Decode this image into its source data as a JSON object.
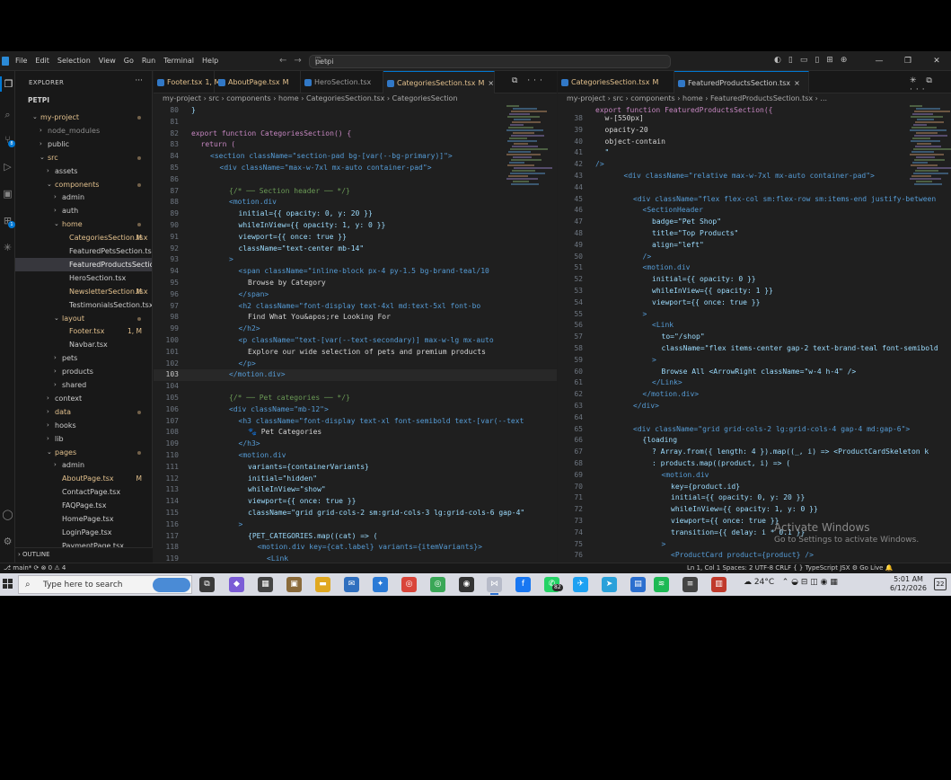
{
  "menu": [
    "File",
    "Edit",
    "Selection",
    "View",
    "Go",
    "Run",
    "Terminal",
    "Help"
  ],
  "command_center": "petpi",
  "sidebar": {
    "title": "EXPLORER",
    "root": "PETPI",
    "outline": "OUTLINE",
    "rows": [
      {
        "label": "my-project",
        "depth": 0,
        "chev": "⌄",
        "color": "#e2c08d",
        "dot": true
      },
      {
        "label": "node_modules",
        "depth": 1,
        "chev": "›",
        "color": "#8c8c8c"
      },
      {
        "label": "public",
        "depth": 1,
        "chev": "›",
        "color": "#cccccc"
      },
      {
        "label": "src",
        "depth": 1,
        "chev": "⌄",
        "color": "#e2c08d",
        "dot": true
      },
      {
        "label": "assets",
        "depth": 2,
        "chev": "›",
        "color": "#cccccc"
      },
      {
        "label": "components",
        "depth": 2,
        "chev": "⌄",
        "color": "#e2c08d",
        "dot": true
      },
      {
        "label": "admin",
        "depth": 3,
        "chev": "›",
        "color": "#cccccc"
      },
      {
        "label": "auth",
        "depth": 3,
        "chev": "›",
        "color": "#cccccc"
      },
      {
        "label": "home",
        "depth": 3,
        "chev": "⌄",
        "color": "#e2c08d",
        "dot": true
      },
      {
        "label": "CategoriesSection.tsx",
        "depth": 4,
        "chev": "",
        "color": "#e2c08d",
        "status": "M"
      },
      {
        "label": "FeaturedPetsSection.tsx",
        "depth": 4,
        "chev": "",
        "color": "#cccccc"
      },
      {
        "label": "FeaturedProductsSection...",
        "depth": 4,
        "chev": "",
        "color": "#e8e8e8",
        "selected": true
      },
      {
        "label": "HeroSection.tsx",
        "depth": 4,
        "chev": "",
        "color": "#cccccc"
      },
      {
        "label": "NewsletterSection.tsx",
        "depth": 4,
        "chev": "",
        "color": "#e2c08d",
        "status": "M"
      },
      {
        "label": "TestimonialsSection.tsx",
        "depth": 4,
        "chev": "",
        "color": "#cccccc"
      },
      {
        "label": "layout",
        "depth": 3,
        "chev": "⌄",
        "color": "#e2c08d",
        "dot": true
      },
      {
        "label": "Footer.tsx",
        "depth": 4,
        "chev": "",
        "color": "#e2c08d",
        "status": "1, M"
      },
      {
        "label": "Navbar.tsx",
        "depth": 4,
        "chev": "",
        "color": "#cccccc"
      },
      {
        "label": "pets",
        "depth": 3,
        "chev": "›",
        "color": "#cccccc"
      },
      {
        "label": "products",
        "depth": 3,
        "chev": "›",
        "color": "#cccccc"
      },
      {
        "label": "shared",
        "depth": 3,
        "chev": "›",
        "color": "#cccccc"
      },
      {
        "label": "context",
        "depth": 2,
        "chev": "›",
        "color": "#cccccc"
      },
      {
        "label": "data",
        "depth": 2,
        "chev": "›",
        "color": "#e2c08d",
        "dot": true
      },
      {
        "label": "hooks",
        "depth": 2,
        "chev": "›",
        "color": "#cccccc"
      },
      {
        "label": "lib",
        "depth": 2,
        "chev": "›",
        "color": "#cccccc"
      },
      {
        "label": "pages",
        "depth": 2,
        "chev": "⌄",
        "color": "#e2c08d",
        "dot": true
      },
      {
        "label": "admin",
        "depth": 3,
        "chev": "›",
        "color": "#cccccc"
      },
      {
        "label": "AboutPage.tsx",
        "depth": 3,
        "chev": "",
        "color": "#e2c08d",
        "status": "M"
      },
      {
        "label": "ContactPage.tsx",
        "depth": 3,
        "chev": "",
        "color": "#cccccc"
      },
      {
        "label": "FAQPage.tsx",
        "depth": 3,
        "chev": "",
        "color": "#cccccc"
      },
      {
        "label": "HomePage.tsx",
        "depth": 3,
        "chev": "",
        "color": "#cccccc"
      },
      {
        "label": "LoginPage.tsx",
        "depth": 3,
        "chev": "",
        "color": "#cccccc"
      },
      {
        "label": "PaymentPage.tsx",
        "depth": 3,
        "chev": "",
        "color": "#cccccc"
      }
    ]
  },
  "left_editor": {
    "tabs": [
      {
        "label": "Footer.tsx",
        "mark": "1, M",
        "color": "#e2c08d",
        "active": false,
        "w": 68
      },
      {
        "label": "AboutPage.tsx",
        "mark": "M",
        "color": "#e2c08d",
        "active": false,
        "w": 96
      },
      {
        "label": "HeroSection.tsx",
        "mark": "",
        "color": "#9a9a9a",
        "active": false,
        "w": 92
      },
      {
        "label": "CategoriesSection.tsx",
        "mark": "M",
        "color": "#e2c08d",
        "active": true,
        "w": 124
      }
    ],
    "breadcrumb": "my-project › src › components › home › CategoriesSection.tsx › CategoriesSection",
    "lines": [
      {
        "n": "80",
        "t": "}",
        "i": 0
      },
      {
        "n": "81",
        "t": "",
        "i": 0
      },
      {
        "n": "82",
        "t": "export function CategoriesSection() {",
        "i": 0
      },
      {
        "n": "83",
        "t": "return (",
        "i": 1
      },
      {
        "n": "84",
        "t": "<section className=\"section-pad bg-[var(--bg-primary)]\">",
        "i": 2
      },
      {
        "n": "85",
        "t": "<div className=\"max-w-7xl mx-auto container-pad\">",
        "i": 3
      },
      {
        "n": "86",
        "t": "",
        "i": 0
      },
      {
        "n": "87",
        "t": "{/* ── Section header ── */}",
        "i": 4
      },
      {
        "n": "88",
        "t": "<motion.div",
        "i": 4
      },
      {
        "n": "89",
        "t": "initial={{ opacity: 0, y: 20 }}",
        "i": 5
      },
      {
        "n": "90",
        "t": "whileInView={{ opacity: 1, y: 0 }}",
        "i": 5
      },
      {
        "n": "91",
        "t": "viewport={{ once: true }}",
        "i": 5
      },
      {
        "n": "92",
        "t": "className=\"text-center mb-14\"",
        "i": 5
      },
      {
        "n": "93",
        "t": ">",
        "i": 4
      },
      {
        "n": "94",
        "t": "<span className=\"inline-block px-4 py-1.5 bg-brand-teal/10",
        "i": 5
      },
      {
        "n": "95",
        "t": "Browse by Category",
        "i": 6
      },
      {
        "n": "96",
        "t": "</span>",
        "i": 5
      },
      {
        "n": "97",
        "t": "<h2 className=\"font-display text-4xl md:text-5xl font-bo",
        "i": 5
      },
      {
        "n": "98",
        "t": "Find What You&apos;re Looking For",
        "i": 6
      },
      {
        "n": "99",
        "t": "</h2>",
        "i": 5
      },
      {
        "n": "100",
        "t": "<p className=\"text-[var(--text-secondary)] max-w-lg mx-auto",
        "i": 5
      },
      {
        "n": "101",
        "t": "Explore our wide selection of pets and premium products",
        "i": 6
      },
      {
        "n": "102",
        "t": "</p>",
        "i": 5
      },
      {
        "n": "103",
        "t": "</motion.div>",
        "i": 4,
        "cur": true
      },
      {
        "n": "104",
        "t": "",
        "i": 0
      },
      {
        "n": "105",
        "t": "{/* ── Pet categories ── */}",
        "i": 4
      },
      {
        "n": "106",
        "t": "<div className=\"mb-12\">",
        "i": 4
      },
      {
        "n": "107",
        "t": "<h3 className=\"font-display text-xl font-semibold text-[var(--text",
        "i": 5
      },
      {
        "n": "108",
        "t": "🐾 Pet Categories",
        "i": 6
      },
      {
        "n": "109",
        "t": "</h3>",
        "i": 5
      },
      {
        "n": "110",
        "t": "<motion.div",
        "i": 5
      },
      {
        "n": "111",
        "t": "variants={containerVariants}",
        "i": 6
      },
      {
        "n": "112",
        "t": "initial=\"hidden\"",
        "i": 6
      },
      {
        "n": "113",
        "t": "whileInView=\"show\"",
        "i": 6
      },
      {
        "n": "114",
        "t": "viewport={{ once: true }}",
        "i": 6
      },
      {
        "n": "115",
        "t": "className=\"grid grid-cols-2 sm:grid-cols-3 lg:grid-cols-6 gap-4\"",
        "i": 6
      },
      {
        "n": "116",
        "t": ">",
        "i": 5
      },
      {
        "n": "117",
        "t": "{PET_CATEGORIES.map((cat) => (",
        "i": 6
      },
      {
        "n": "118",
        "t": "<motion.div key={cat.label} variants={itemVariants}>",
        "i": 7
      },
      {
        "n": "119",
        "t": "<Link",
        "i": 8
      }
    ]
  },
  "right_editor": {
    "tabs": [
      {
        "label": "CategoriesSection.tsx",
        "mark": "M",
        "color": "#e2c08d",
        "active": false,
        "w": 130
      },
      {
        "label": "FeaturedProductsSection.tsx",
        "mark": "",
        "color": "#cccccc",
        "active": true,
        "w": 150
      }
    ],
    "breadcrumb": "my-project › src › components › home › FeaturedProductsSection.tsx › ...",
    "sticky": "export function FeaturedProductsSection({",
    "lines": [
      {
        "n": "38",
        "t": "w-[550px]",
        "i": 1
      },
      {
        "n": "39",
        "t": "opacity-20",
        "i": 1
      },
      {
        "n": "40",
        "t": "object-contain",
        "i": 1
      },
      {
        "n": "41",
        "t": "\"",
        "i": 1
      },
      {
        "n": "42",
        "t": "/>",
        "i": 0
      },
      {
        "n": "43",
        "t": "<div className=\"relative max-w-7xl mx-auto container-pad\">",
        "i": 3
      },
      {
        "n": "44",
        "t": "",
        "i": 0
      },
      {
        "n": "45",
        "t": "<div className=\"flex flex-col sm:flex-row sm:items-end justify-between",
        "i": 4
      },
      {
        "n": "46",
        "t": "<SectionHeader",
        "i": 5
      },
      {
        "n": "47",
        "t": "badge=\"Pet Shop\"",
        "i": 6
      },
      {
        "n": "48",
        "t": "title=\"Top Products\"",
        "i": 6
      },
      {
        "n": "49",
        "t": "align=\"left\"",
        "i": 6
      },
      {
        "n": "50",
        "t": "/>",
        "i": 5
      },
      {
        "n": "51",
        "t": "<motion.div",
        "i": 5
      },
      {
        "n": "52",
        "t": "initial={{ opacity: 0 }}",
        "i": 6
      },
      {
        "n": "53",
        "t": "whileInView={{ opacity: 1 }}",
        "i": 6
      },
      {
        "n": "54",
        "t": "viewport={{ once: true }}",
        "i": 6
      },
      {
        "n": "55",
        "t": ">",
        "i": 5
      },
      {
        "n": "56",
        "t": "<Link",
        "i": 6
      },
      {
        "n": "57",
        "t": "to=\"/shop\"",
        "i": 7
      },
      {
        "n": "58",
        "t": "className=\"flex items-center gap-2 text-brand-teal font-semibold",
        "i": 7
      },
      {
        "n": "59",
        "t": ">",
        "i": 6
      },
      {
        "n": "60",
        "t": "Browse All <ArrowRight className=\"w-4 h-4\" />",
        "i": 7
      },
      {
        "n": "61",
        "t": "</Link>",
        "i": 6
      },
      {
        "n": "62",
        "t": "</motion.div>",
        "i": 5
      },
      {
        "n": "63",
        "t": "</div>",
        "i": 4
      },
      {
        "n": "64",
        "t": "",
        "i": 0
      },
      {
        "n": "65",
        "t": "<div className=\"grid grid-cols-2 lg:grid-cols-4 gap-4 md:gap-6\">",
        "i": 4
      },
      {
        "n": "66",
        "t": "{loading",
        "i": 5
      },
      {
        "n": "67",
        "t": "? Array.from({ length: 4 }).map((_, i) => <ProductCardSkeleton k",
        "i": 6
      },
      {
        "n": "68",
        "t": ": products.map((product, i) => (",
        "i": 6
      },
      {
        "n": "69",
        "t": "<motion.div",
        "i": 7
      },
      {
        "n": "70",
        "t": "key={product.id}",
        "i": 8
      },
      {
        "n": "71",
        "t": "initial={{ opacity: 0, y: 20 }}",
        "i": 8
      },
      {
        "n": "72",
        "t": "whileInView={{ opacity: 1, y: 0 }}",
        "i": 8
      },
      {
        "n": "73",
        "t": "viewport={{ once: true }}",
        "i": 8
      },
      {
        "n": "74",
        "t": "transition={{ delay: i * 0.1 }}",
        "i": 8
      },
      {
        "n": "75",
        "t": ">",
        "i": 7
      },
      {
        "n": "76",
        "t": "<ProductCard product={product} />",
        "i": 8
      }
    ]
  },
  "watermark": {
    "line1": "Activate Windows",
    "line2": "Go to Settings to activate Windows."
  },
  "status": {
    "left": "⎇ main*  ⟳   ⊗ 0 ⚠ 4",
    "right": "Ln 1, Col 1    Spaces: 2    UTF-8    CRLF    { } TypeScript JSX    ⚙ Go Live    🔔"
  },
  "taskbar": {
    "search_placeholder": "Type here to search",
    "badge_count": "82",
    "temperature": "24°C",
    "time": "5:01 AM",
    "date": "6/12/2026",
    "notifications": "22"
  }
}
